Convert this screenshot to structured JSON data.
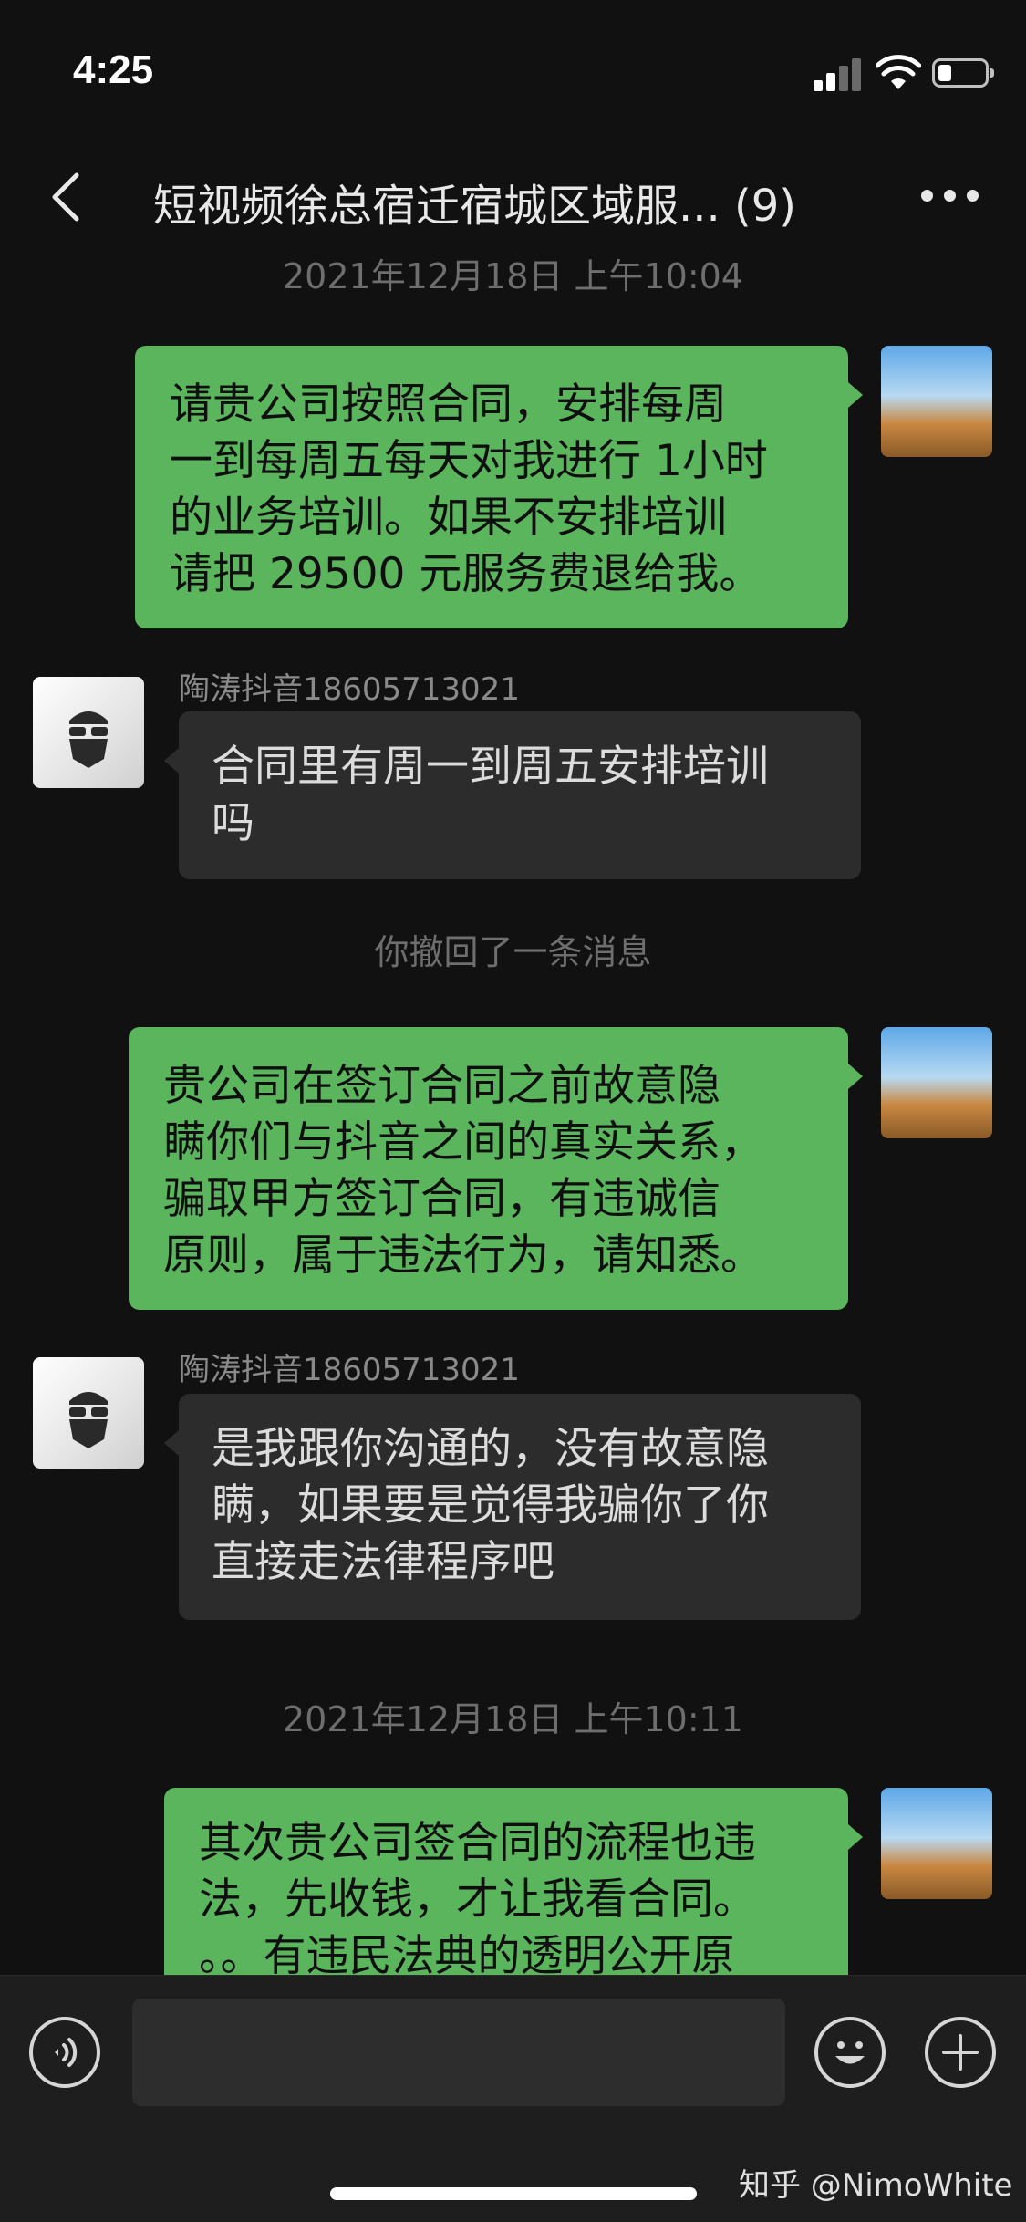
{
  "status_bar": {
    "time": "4:25"
  },
  "nav": {
    "title": "短视频徐总宿迁宿城区域服... (9)"
  },
  "messages": {
    "timestamp_1": "2021年12月18日 上午10:04",
    "msg1": {
      "lines": [
        "请贵公司按照合同，安排每周",
        "一到每周五每天对我进行 1小时",
        "的业务培训。如果不安排培训",
        "请把 29500 元服务费退给我。"
      ]
    },
    "msg2": {
      "sender": "陶涛抖音18605713021",
      "lines": [
        "合同里有周一到周五安排培训",
        "吗"
      ]
    },
    "recall_notice": "你撤回了一条消息",
    "msg3": {
      "lines": [
        "贵公司在签订合同之前故意隐",
        "瞒你们与抖音之间的真实关系，",
        "骗取甲方签订合同，有违诚信",
        "原则，属于违法行为，请知悉。"
      ]
    },
    "msg4": {
      "sender": "陶涛抖音18605713021",
      "lines": [
        "是我跟你沟通的，没有故意隐",
        "瞒，如果要是觉得我骗你了你",
        "直接走法律程序吧"
      ]
    },
    "timestamp_2": "2021年12月18日 上午10:11",
    "msg5": {
      "lines": [
        "其次贵公司签合同的流程也违",
        "法，先收钱，才让我看合同。",
        "。。有违民法典的透明公开原"
      ]
    }
  },
  "watermark": "知乎 @NimoWhite",
  "colors": {
    "background": "#111111",
    "self_bubble": "#5ab55d",
    "other_bubble": "#2c2c2c",
    "input_bar": "#1e1e1e"
  },
  "icons": {
    "nav_back": "chevron-left-icon",
    "nav_more": "more-horizontal-icon",
    "voice": "voice-icon",
    "emoji": "emoji-icon",
    "plus": "plus-icon"
  }
}
